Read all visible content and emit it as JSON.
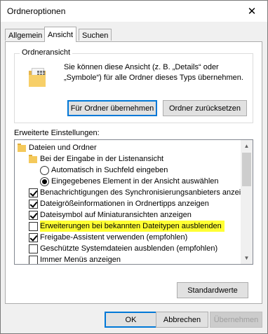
{
  "window": {
    "title": "Ordneroptionen",
    "close_glyph": "✕"
  },
  "tabs": [
    {
      "label": "Allgemein"
    },
    {
      "label": "Ansicht",
      "active": true
    },
    {
      "label": "Suchen"
    }
  ],
  "folder_view": {
    "group_label": "Ordneransicht",
    "description": "Sie können diese Ansicht (z. B. „Details“ oder „Symbole“) für alle Ordner dieses Typs übernehmen.",
    "apply_button": "Für Ordner übernehmen",
    "reset_button": "Ordner zurücksetzen"
  },
  "advanced": {
    "label": "Erweiterte Einstellungen:",
    "items": [
      {
        "type": "folder",
        "indent": 0,
        "label": "Dateien und Ordner"
      },
      {
        "type": "folder",
        "indent": 1,
        "label": "Bei der Eingabe in der Listenansicht"
      },
      {
        "type": "radio",
        "indent": 2,
        "checked": false,
        "label": "Automatisch in Suchfeld eingeben"
      },
      {
        "type": "radio",
        "indent": 2,
        "checked": true,
        "label": "Eingegebenes Element in der Ansicht auswählen"
      },
      {
        "type": "checkbox",
        "indent": 1,
        "checked": true,
        "label": "Benachrichtigungen des Synchronisierungsanbieters anzeigen"
      },
      {
        "type": "checkbox",
        "indent": 1,
        "checked": true,
        "label": "Dateigrößeinformationen in Ordnertipps anzeigen"
      },
      {
        "type": "checkbox",
        "indent": 1,
        "checked": true,
        "label": "Dateisymbol auf Miniaturansichten anzeigen"
      },
      {
        "type": "checkbox",
        "indent": 1,
        "checked": false,
        "highlighted": true,
        "label": "Erweiterungen bei bekannten Dateitypen ausblenden"
      },
      {
        "type": "checkbox",
        "indent": 1,
        "checked": true,
        "label": "Freigabe-Assistent verwenden (empfohlen)"
      },
      {
        "type": "checkbox",
        "indent": 1,
        "checked": false,
        "label": "Geschützte Systemdateien ausblenden (empfohlen)"
      },
      {
        "type": "checkbox",
        "indent": 1,
        "checked": false,
        "label": "Immer Menüs anzeigen"
      }
    ],
    "scroll_up": "▲",
    "scroll_down": "▼",
    "defaults_button": "Standardwerte"
  },
  "footer": {
    "ok": "OK",
    "cancel": "Abbrechen",
    "apply": "Übernehmen"
  },
  "colors": {
    "accent": "#0078d7",
    "highlight": "#ffff33"
  }
}
